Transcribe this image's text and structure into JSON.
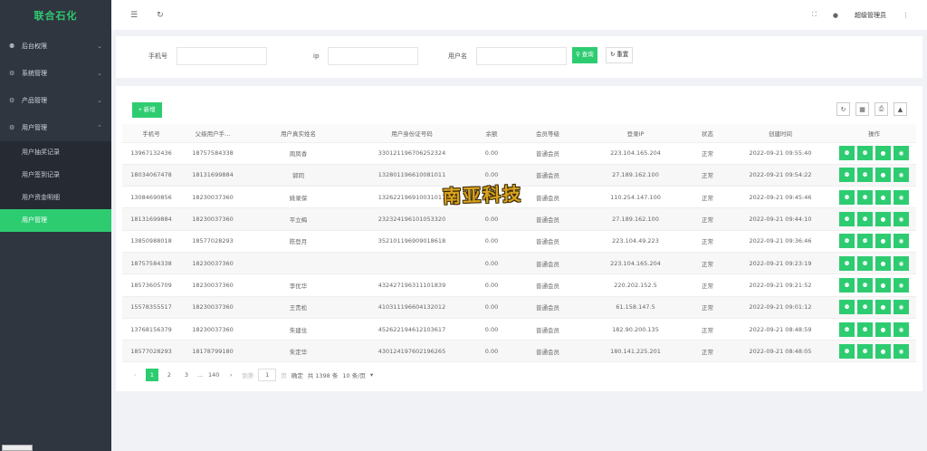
{
  "app": {
    "title": "联合石化"
  },
  "sidebar": {
    "groups": [
      {
        "label": "后台权限",
        "icon": "user-icon",
        "expanded": false
      },
      {
        "label": "系统管理",
        "icon": "gear-icon",
        "expanded": false
      },
      {
        "label": "产品管理",
        "icon": "gear-icon",
        "expanded": false
      },
      {
        "label": "用户管理",
        "icon": "gear-icon",
        "expanded": true
      }
    ],
    "sub_items": [
      {
        "label": "用户抽奖记录",
        "active": false
      },
      {
        "label": "用户签到记录",
        "active": false
      },
      {
        "label": "用户资金明细",
        "active": false
      },
      {
        "label": "用户管理",
        "active": true
      }
    ]
  },
  "topbar": {
    "menu_icon": "☰",
    "refresh_icon": "↻",
    "fullscreen_icon": "⛶",
    "theme_icon": "●",
    "user": "超级管理员",
    "more_icon": "⋮"
  },
  "search": {
    "phone_label": "手机号",
    "ip_label": "ip",
    "username_label": "用户名",
    "search_btn": "查询",
    "reset_btn": "重置"
  },
  "table": {
    "add_btn": "+ 新增",
    "columns": [
      "手机号",
      "父级用户手...",
      "用户真实姓名",
      "用户身份证号码",
      "余额",
      "会员等级",
      "登录IP",
      "状态",
      "创建时间",
      "操作"
    ],
    "rows": [
      [
        "13967132436",
        "18757584338",
        "周凤香",
        "330121196706252324",
        "0.00",
        "普通会员",
        "223.104.165.204",
        "正常",
        "2022-09-21 09:55:40"
      ],
      [
        "18034067478",
        "18131699884",
        "郭同",
        "132801196610081011",
        "0.00",
        "普通会员",
        "27.189.162.100",
        "正常",
        "2022-09-21 09:54:22"
      ],
      [
        "13084690856",
        "18230037360",
        "姚录保",
        "132622196910031017",
        "0.00",
        "普通会员",
        "110.254.147.100",
        "正常",
        "2022-09-21 09:45:46"
      ],
      [
        "18131699884",
        "18230037360",
        "平立梅",
        "232324196101053320",
        "0.00",
        "普通会员",
        "27.189.162.100",
        "正常",
        "2022-09-21 09:44:10"
      ],
      [
        "13850988018",
        "18577028293",
        "陈登月",
        "352101196909018618",
        "0.00",
        "普通会员",
        "223.104.49.223",
        "正常",
        "2022-09-21 09:36:46"
      ],
      [
        "18757584338",
        "18230037360",
        "",
        "",
        "0.00",
        "普通会员",
        "223.104.165.204",
        "正常",
        "2022-09-21 09:23:19"
      ],
      [
        "18573605709",
        "18230037360",
        "李优华",
        "432427196311101839",
        "0.00",
        "普通会员",
        "220.202.152.5",
        "正常",
        "2022-09-21 09:21:52"
      ],
      [
        "15578355517",
        "18230037360",
        "王贵松",
        "410311196604132012",
        "0.00",
        "普通会员",
        "61.158.147.5",
        "正常",
        "2022-09-21 09:01:12"
      ],
      [
        "13768156379",
        "18230037360",
        "朱建住",
        "452622194612103617",
        "0.00",
        "普通会员",
        "182.90.200.135",
        "正常",
        "2022-09-21 08:48:59"
      ],
      [
        "18577028293",
        "18178799180",
        "朱定华",
        "430124197602196265",
        "0.00",
        "普通会员",
        "180.141.225.201",
        "正常",
        "2022-09-21 08:48:05"
      ]
    ],
    "op_icons": [
      "person-icon",
      "person-icon",
      "dot-icon",
      "record-icon"
    ]
  },
  "pager": {
    "prev": "‹",
    "pages": [
      "1",
      "2",
      "3"
    ],
    "ellipsis": "...",
    "last": "140",
    "next": "›",
    "goto_label": "到第",
    "goto_value": "1",
    "page_unit": "页",
    "confirm": "确定",
    "total": "共 1398 条",
    "page_size": "10 条/页"
  },
  "watermark": "南亚科技",
  "colors": {
    "accent": "#2ecc71",
    "sidebar": "#2f3640"
  }
}
